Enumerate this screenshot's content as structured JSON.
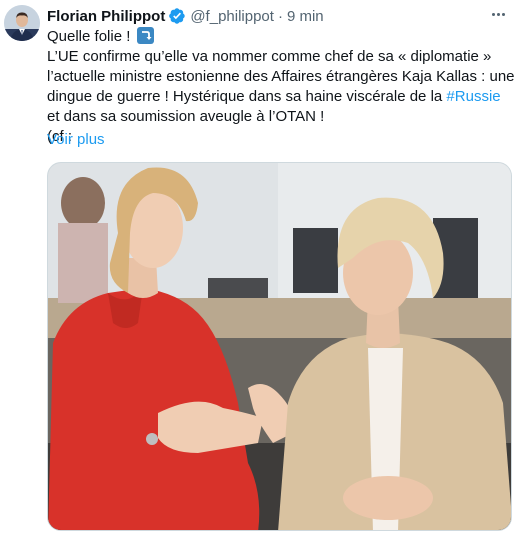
{
  "author": {
    "name": "Florian Philippot",
    "handle": "@f_philippot",
    "separator": "·",
    "time": "9 min",
    "verified": true,
    "avatar_icon": "profile-photo"
  },
  "tweet": {
    "line1": "Quelle folie !",
    "line1_emoji": "right-arrow-curving-down-emoji",
    "body_before_hashtag": "L’UE confirme qu’elle va nommer comme chef de sa « diplomatie » l’actuelle ministre estonienne des Affaires étrangères Kaja Kallas : une dingue de guerre ! Hystérique dans sa haine viscérale de la ",
    "hashtag": "#Russie",
    "body_after_hashtag": " et dans sa soumission aveugle à l’OTAN !",
    "line_last": "(cf :",
    "show_more": "Voir plus"
  },
  "colors": {
    "link": "#1d9bf0",
    "text": "#0f1419",
    "muted": "#536471",
    "verified_badge": "#1d9bf0",
    "emoji_bg": "#3b88c3"
  },
  "media": {
    "description_icon": "photo-two-women-talking"
  }
}
